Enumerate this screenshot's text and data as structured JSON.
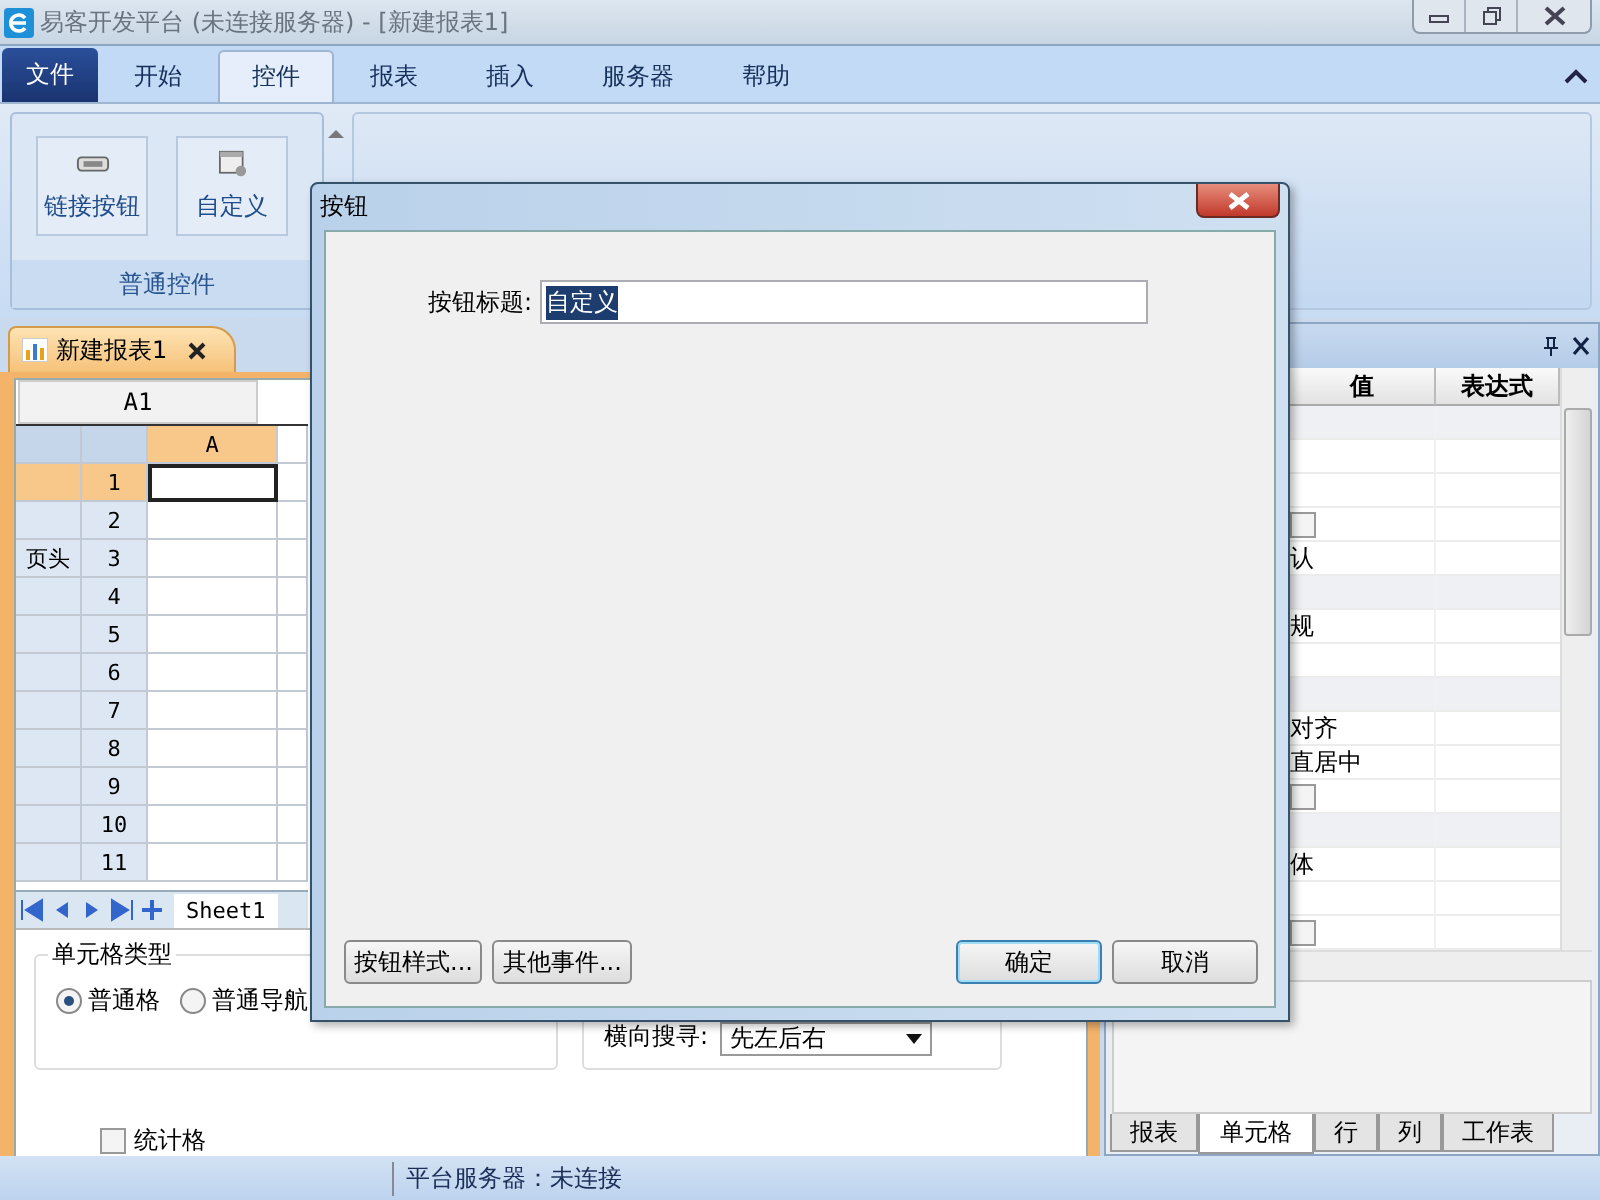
{
  "window": {
    "title": "易客开发平台 (未连接服务器) - [新建报表1]"
  },
  "ribbon_tabs": [
    {
      "label": "文件",
      "kind": "file",
      "selected": false
    },
    {
      "label": "开始",
      "kind": "tab",
      "selected": false
    },
    {
      "label": "控件",
      "kind": "tab",
      "selected": true
    },
    {
      "label": "报表",
      "kind": "tab",
      "selected": false
    },
    {
      "label": "插入",
      "kind": "tab",
      "selected": false
    },
    {
      "label": "服务器",
      "kind": "tab",
      "selected": false
    },
    {
      "label": "帮助",
      "kind": "tab",
      "selected": false
    }
  ],
  "ribbon_group": {
    "label": "普通控件",
    "buttons": [
      {
        "label": "链接按钮",
        "kind": "link"
      },
      {
        "label": "自定义",
        "kind": "custom"
      }
    ]
  },
  "document_tab": {
    "label": "新建报表1"
  },
  "cell_name": "A1",
  "grid": {
    "columns": [
      "A"
    ],
    "rows": [
      {
        "number": "1",
        "selected": true
      },
      {
        "number": "2",
        "selected": false
      },
      {
        "number": "3",
        "band": "页头",
        "selected": false
      },
      {
        "number": "4",
        "selected": false
      },
      {
        "number": "5",
        "selected": false
      },
      {
        "number": "6",
        "selected": false
      },
      {
        "number": "7",
        "selected": false
      },
      {
        "number": "8",
        "selected": false
      },
      {
        "number": "9",
        "selected": false
      },
      {
        "number": "10",
        "selected": false
      },
      {
        "number": "11",
        "selected": false
      }
    ]
  },
  "sheet_tabs": [
    {
      "label": "Sheet1",
      "selected": true
    }
  ],
  "cell_type": {
    "title": "单元格类型",
    "options": [
      {
        "label": "普通格",
        "selected": true
      },
      {
        "label": "普通导航",
        "selected": false
      }
    ]
  },
  "horizontal_search": {
    "label": "横向搜寻:",
    "value": "先左后右"
  },
  "stat_cell": {
    "label": "统计格",
    "checked": false
  },
  "properties": {
    "columns": [
      "值",
      "表达式"
    ],
    "rows": [
      {
        "kind": "group"
      },
      {
        "kind": "blank"
      },
      {
        "kind": "blank"
      },
      {
        "kind": "check",
        "checked": false
      },
      {
        "kind": "text",
        "value": "认"
      },
      {
        "kind": "group"
      },
      {
        "kind": "text",
        "value": "规"
      },
      {
        "kind": "blank"
      },
      {
        "kind": "group"
      },
      {
        "kind": "text",
        "value": "对齐"
      },
      {
        "kind": "text",
        "value": "直居中"
      },
      {
        "kind": "check",
        "checked": false
      },
      {
        "kind": "group"
      },
      {
        "kind": "text",
        "value": "体"
      },
      {
        "kind": "blank"
      },
      {
        "kind": "check",
        "checked": false
      }
    ]
  },
  "panel_tabs": [
    {
      "label": "报表",
      "selected": false
    },
    {
      "label": "单元格",
      "selected": true
    },
    {
      "label": "行",
      "selected": false
    },
    {
      "label": "列",
      "selected": false
    },
    {
      "label": "工作表",
      "selected": false
    }
  ],
  "status_bar": "平台服务器：未连接",
  "dialog": {
    "title": "按钮",
    "field_label": "按钮标题:",
    "field_value": "自定义",
    "value_selected": true,
    "left_buttons": [
      {
        "label": "按钮样式...",
        "default": false
      },
      {
        "label": "其他事件...",
        "default": false
      }
    ],
    "right_buttons": [
      {
        "label": "确定",
        "default": true
      },
      {
        "label": "取消",
        "default": false
      }
    ]
  }
}
